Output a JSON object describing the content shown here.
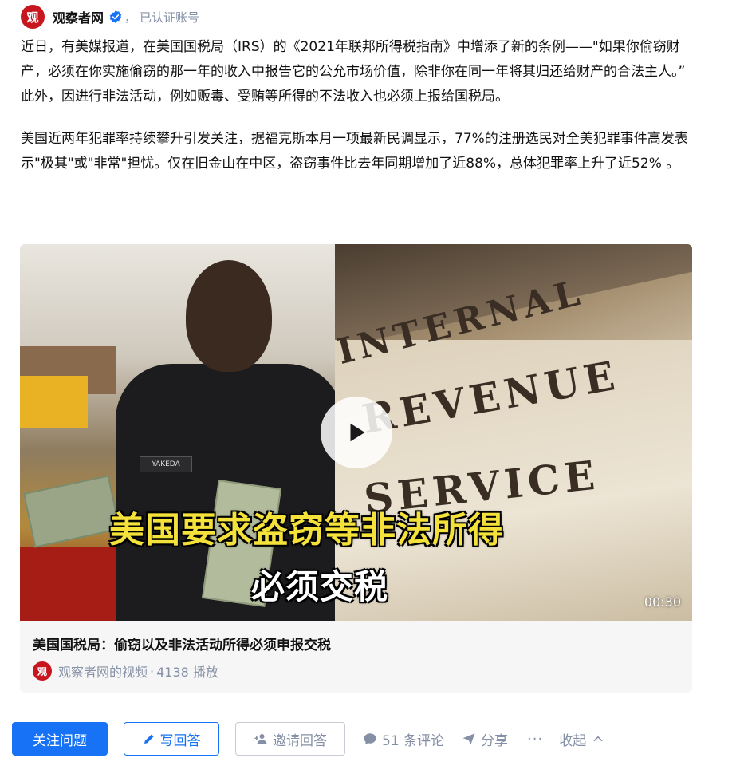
{
  "author": {
    "logo_text": "观",
    "name": "观察者网",
    "separator": "，",
    "badge": "已认证账号"
  },
  "article": {
    "paragraphs": [
      "近日，有美媒报道，在美国国税局（IRS）的《2021年联邦所得税指南》中增添了新的条例——\"如果你偷窃财产，必须在你实施偷窃的那一年的收入中报告它的公允市场价值，除非你在同一年将其归还给财产的合法主人。” 此外，因进行非法活动，例如贩毒、受贿等所得的不法收入也必须上报给国税局。",
      "美国近两年犯罪率持续攀升引发关注，据福克斯本月一项最新民调显示，77%的注册选民对全美犯罪事件高发表示\"极其\"或\"非常\"担忧。仅在旧金山在中区，盗窃事件比去年同期增加了近88%，总体犯罪率上升了近52% 。"
    ]
  },
  "video": {
    "thumbnail": {
      "caption_line1": "美国要求盗窃等非法所得",
      "caption_line2": "必须交税",
      "sign_lines": [
        "INTERNAL",
        "REVENUE",
        "SERVICE"
      ],
      "vest_tag": "YAKEDA"
    },
    "duration": "00:30",
    "title": "美国国税局：偷窃以及非法活动所得必须申报交税",
    "source": "观察者网的视频",
    "separator": "·",
    "views": "4138 播放"
  },
  "actions": {
    "follow": "关注问题",
    "write_answer": "写回答",
    "invite_answer": "邀请回答",
    "comments": "51 条评论",
    "share": "分享",
    "more": "···",
    "collapse": "收起"
  },
  "colors": {
    "accent": "#1772f6",
    "muted": "#8590a6",
    "logo_red": "#c7161e",
    "caption_yellow": "#f4e23b"
  },
  "icons": [
    "verified-icon",
    "play-icon",
    "pen-icon",
    "invite-icon",
    "comment-icon",
    "share-icon",
    "chevron-up-icon"
  ]
}
